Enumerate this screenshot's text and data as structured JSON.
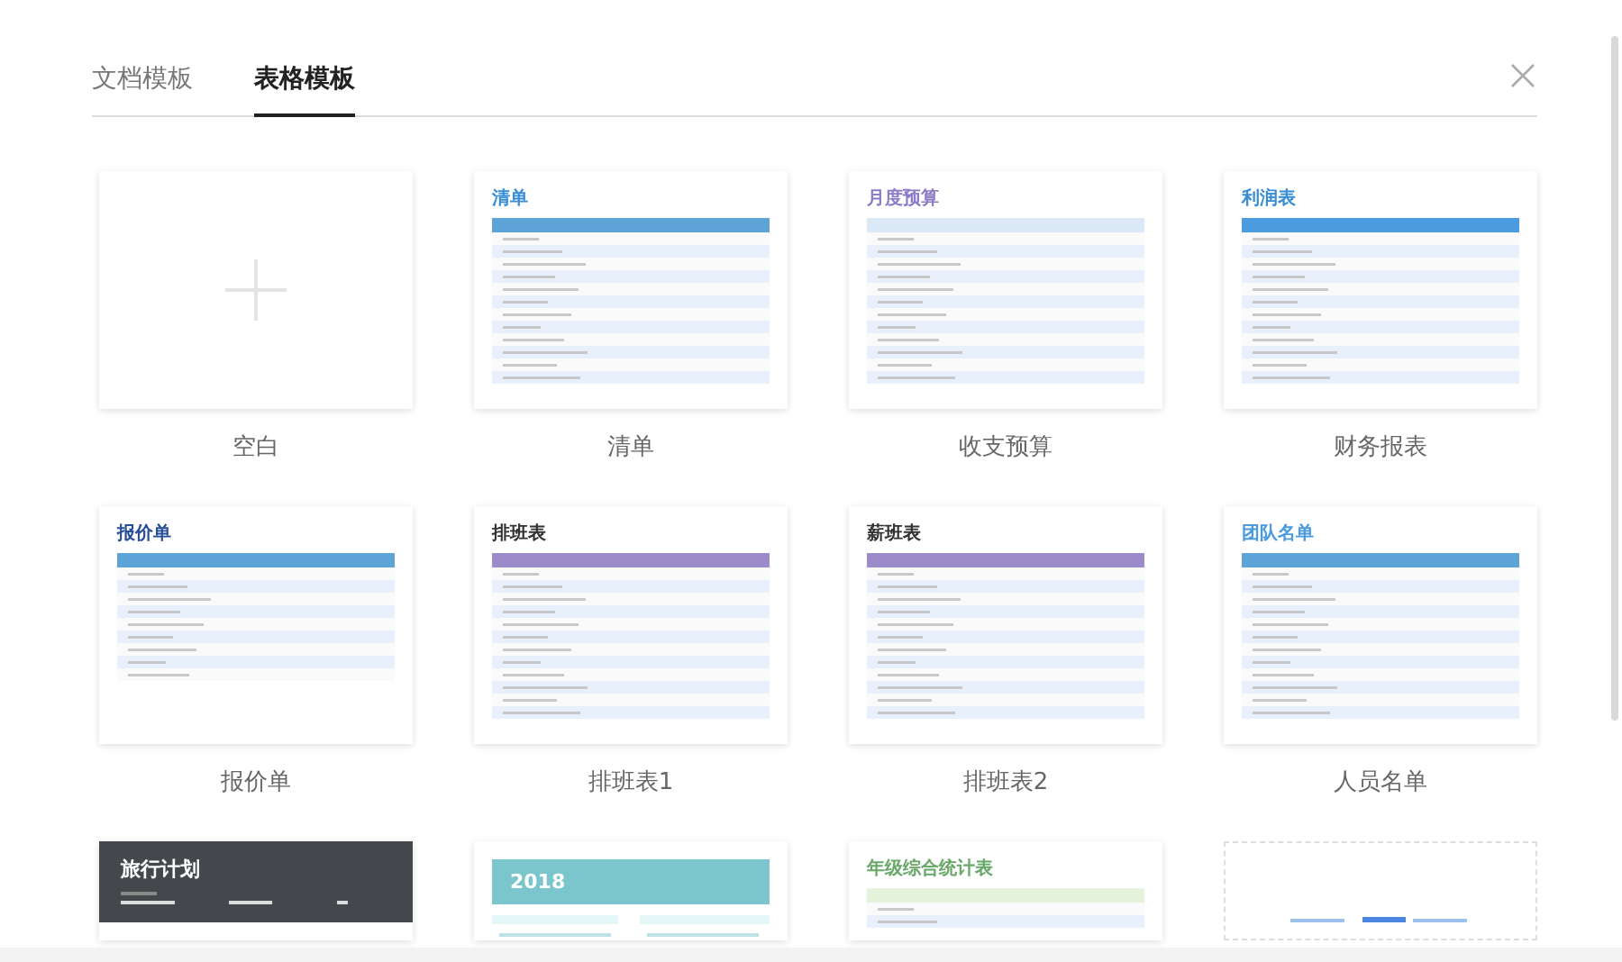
{
  "tabs": [
    {
      "label": "文档模板",
      "selected": false
    },
    {
      "label": "表格模板",
      "selected": true
    }
  ],
  "templates": [
    {
      "kind": "blank",
      "label": "空白"
    },
    {
      "kind": "list",
      "label": "清单",
      "preview_title": "清单"
    },
    {
      "kind": "budget",
      "label": "收支预算",
      "preview_title": "月度预算"
    },
    {
      "kind": "finance",
      "label": "财务报表",
      "preview_title": "利润表"
    },
    {
      "kind": "quote",
      "label": "报价单",
      "preview_title": "报价单"
    },
    {
      "kind": "schedule",
      "label": "排班表1",
      "preview_title": "排班表"
    },
    {
      "kind": "shift",
      "label": "排班表2",
      "preview_title": "薪班表"
    },
    {
      "kind": "team",
      "label": "人员名单",
      "preview_title": "团队名单"
    },
    {
      "kind": "travel",
      "preview_title": "旅行计划"
    },
    {
      "kind": "calendar",
      "preview_title": "2018"
    },
    {
      "kind": "stats",
      "preview_title": "年级综合统计表"
    },
    {
      "kind": "more"
    }
  ]
}
